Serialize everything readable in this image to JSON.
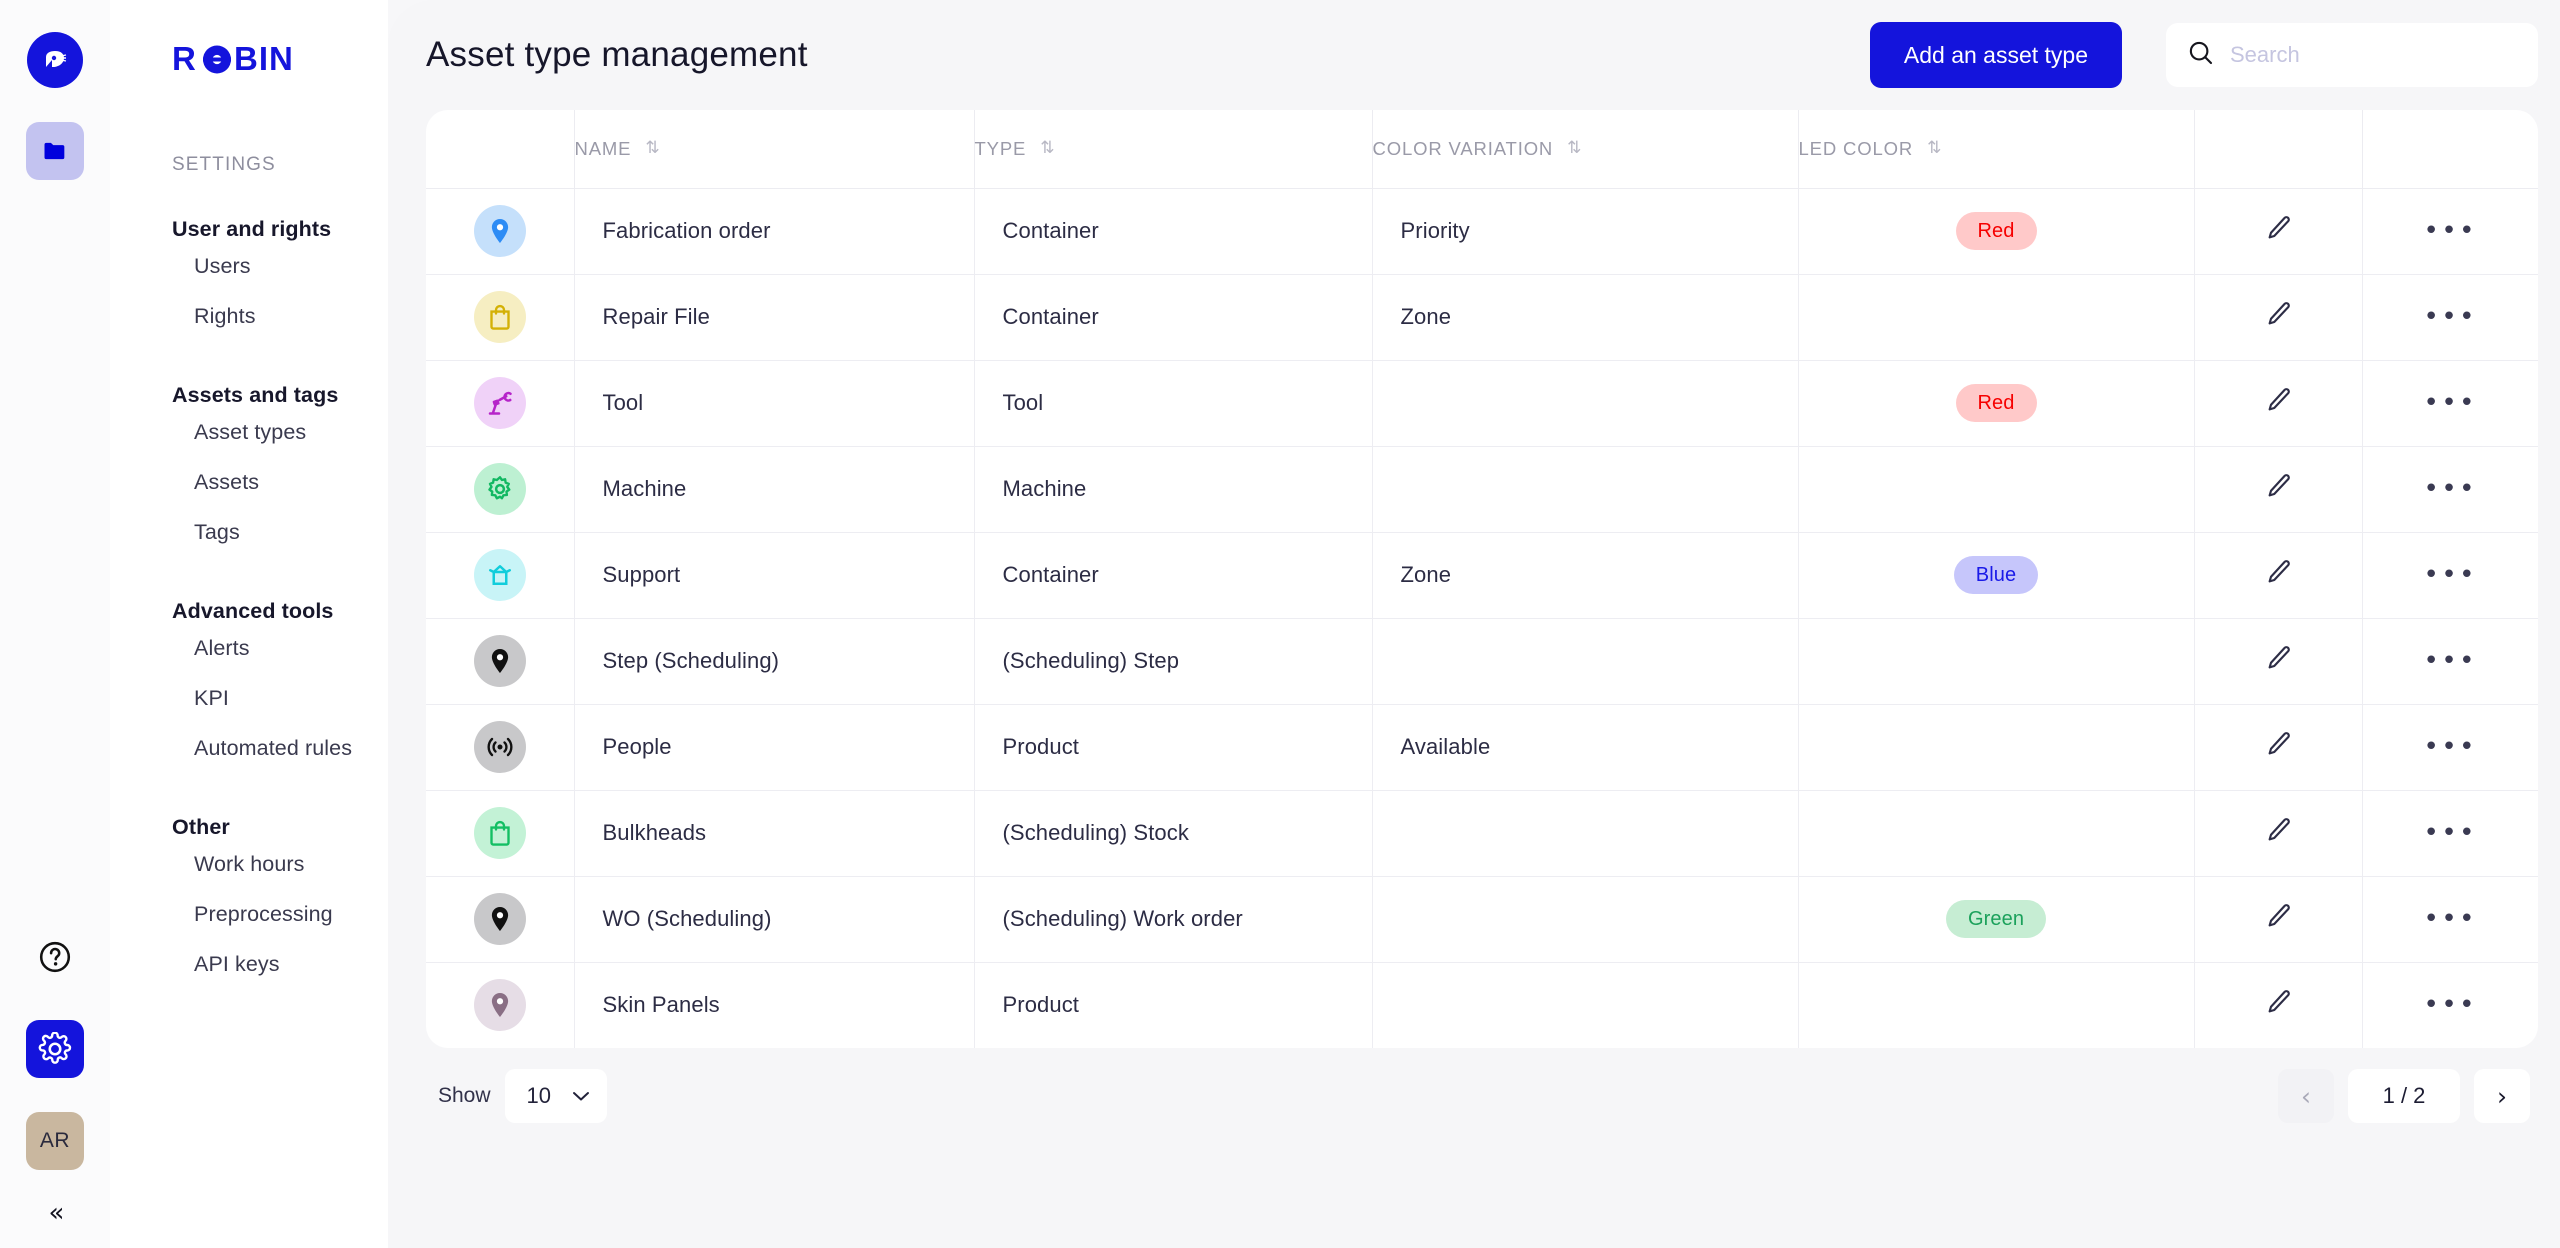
{
  "brand": {
    "name": "ROBIN",
    "logo_icon": "robin-bird-logo-icon"
  },
  "rail": {
    "items": [
      {
        "name": "folder-icon",
        "label": "Folder",
        "active": false
      },
      {
        "name": "help-icon",
        "label": "Help",
        "active": false
      },
      {
        "name": "gear-icon",
        "label": "Settings",
        "active": true
      },
      {
        "name": "avatar",
        "label": "AR",
        "active": false
      },
      {
        "name": "collapse-icon",
        "label": "«",
        "active": false
      }
    ],
    "avatar_initials": "AR",
    "collapse_glyph": "«"
  },
  "sidebar": {
    "eyebrow": "SETTINGS",
    "groups": [
      {
        "title": "User and rights",
        "items": [
          "Users",
          "Rights"
        ]
      },
      {
        "title": "Assets and tags",
        "items": [
          "Asset types",
          "Assets",
          "Tags"
        ]
      },
      {
        "title": "Advanced tools",
        "items": [
          "Alerts",
          "KPI",
          "Automated rules"
        ]
      },
      {
        "title": "Other",
        "items": [
          "Work hours",
          "Preprocessing",
          "API keys"
        ]
      }
    ]
  },
  "header": {
    "title": "Asset type management",
    "add_button": "Add an asset type",
    "search_placeholder": "Search",
    "search_value": ""
  },
  "table": {
    "columns": [
      {
        "label": "",
        "sortable": false
      },
      {
        "label": "NAME",
        "sortable": true
      },
      {
        "label": "TYPE",
        "sortable": true
      },
      {
        "label": "COLOR VARIATION",
        "sortable": true
      },
      {
        "label": "LED COLOR",
        "sortable": true
      },
      {
        "label": "",
        "sortable": false
      },
      {
        "label": "",
        "sortable": false
      }
    ],
    "sort_glyph": "⇅",
    "edit_icon": "pencil-icon",
    "more_icon": "more-options-icon",
    "more_glyph": "•••",
    "rows": [
      {
        "icon": "map-pin-icon",
        "icon_fg": "#2d8cf5",
        "icon_bg": "#c5e0fb",
        "name": "Fabrication order",
        "type": "Container",
        "variation": "Priority",
        "led": "Red",
        "led_class": "badge-red"
      },
      {
        "icon": "bag-icon",
        "icon_fg": "#d4b106",
        "icon_bg": "#f6eec2",
        "name": "Repair File",
        "type": "Container",
        "variation": "Zone",
        "led": "",
        "led_class": ""
      },
      {
        "icon": "robot-arm-icon",
        "icon_fg": "#b624c9",
        "icon_bg": "#f0d2f8",
        "name": "Tool",
        "type": "Tool",
        "variation": "",
        "led": "Red",
        "led_class": "badge-red"
      },
      {
        "icon": "gear-icon",
        "icon_fg": "#12b862",
        "icon_bg": "#bdf0d2",
        "name": "Machine",
        "type": "Machine",
        "variation": "",
        "led": "",
        "led_class": ""
      },
      {
        "icon": "support-icon",
        "icon_fg": "#11cddb",
        "icon_bg": "#c8f4f7",
        "name": "Support",
        "type": "Container",
        "variation": "Zone",
        "led": "Blue",
        "led_class": "badge-blue"
      },
      {
        "icon": "map-pin-icon",
        "icon_fg": "#111111",
        "icon_bg": "#c8c8ca",
        "name": "Step (Scheduling)",
        "type": "(Scheduling) Step",
        "variation": "",
        "led": "",
        "led_class": ""
      },
      {
        "icon": "signal-icon",
        "icon_fg": "#111111",
        "icon_bg": "#c8c8ca",
        "name": "People",
        "type": "Product",
        "variation": "Available",
        "led": "",
        "led_class": ""
      },
      {
        "icon": "bag-icon",
        "icon_fg": "#13bf63",
        "icon_bg": "#c3f2d6",
        "name": "Bulkheads",
        "type": "(Scheduling) Stock",
        "variation": "",
        "led": "",
        "led_class": ""
      },
      {
        "icon": "map-pin-icon",
        "icon_fg": "#111111",
        "icon_bg": "#c8c8ca",
        "name": "WO (Scheduling)",
        "type": "(Scheduling) Work order",
        "variation": "",
        "led": "Green",
        "led_class": "badge-green"
      },
      {
        "icon": "map-pin-icon",
        "icon_fg": "#8a6f85",
        "icon_bg": "#e6dde6",
        "name": "Skin Panels",
        "type": "Product",
        "variation": "",
        "led": "",
        "led_class": ""
      }
    ]
  },
  "footer": {
    "show_label": "Show",
    "page_size": "10",
    "page_size_caret": "⌄",
    "prev_glyph": "‹",
    "next_glyph": "›",
    "page_indicator": "1 / 2"
  },
  "colors": {
    "brand_blue": "#1414dc",
    "page_bg": "#f6f6f8",
    "card_bg": "#ffffff"
  }
}
